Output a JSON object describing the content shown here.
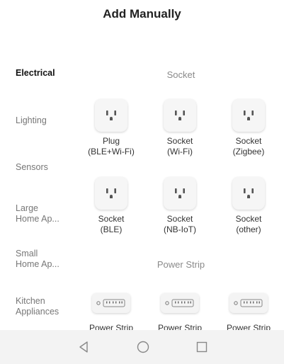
{
  "header": {
    "title": "Add Manually"
  },
  "sidebar": {
    "categories": [
      {
        "line1": "Electrical",
        "line2": ""
      },
      {
        "line1": "Lighting",
        "line2": ""
      },
      {
        "line1": "Sensors",
        "line2": ""
      },
      {
        "line1": "Large",
        "line2": "Home Ap..."
      },
      {
        "line1": "Small",
        "line2": "Home Ap..."
      },
      {
        "line1": "Kitchen",
        "line2": "Appliances"
      }
    ],
    "active_index": 0
  },
  "main": {
    "sections": [
      {
        "title": "Socket",
        "items": [
          {
            "line1": "Plug",
            "line2": "(BLE+Wi-Fi)",
            "icon": "socket-icon"
          },
          {
            "line1": "Socket",
            "line2": "(Wi-Fi)",
            "icon": "socket-icon"
          },
          {
            "line1": "Socket",
            "line2": "(Zigbee)",
            "icon": "socket-icon"
          },
          {
            "line1": "Socket",
            "line2": "(BLE)",
            "icon": "socket-icon"
          },
          {
            "line1": "Socket",
            "line2": "(NB-IoT)",
            "icon": "socket-icon"
          },
          {
            "line1": "Socket",
            "line2": "(other)",
            "icon": "socket-icon"
          }
        ]
      },
      {
        "title": "Power Strip",
        "items": [
          {
            "line1": "Power Strip",
            "line2": "",
            "icon": "power-strip-icon"
          },
          {
            "line1": "Power Strip",
            "line2": "",
            "icon": "power-strip-icon"
          },
          {
            "line1": "Power Strip",
            "line2": "",
            "icon": "power-strip-icon"
          }
        ]
      }
    ]
  },
  "navbar": {
    "buttons": [
      "back-icon",
      "home-icon",
      "recents-icon"
    ]
  },
  "colors": {
    "accent_active": "#111111",
    "muted": "#777777",
    "tile_bg": "#f6f6f6",
    "navbar_bg": "#f3f3f3"
  }
}
